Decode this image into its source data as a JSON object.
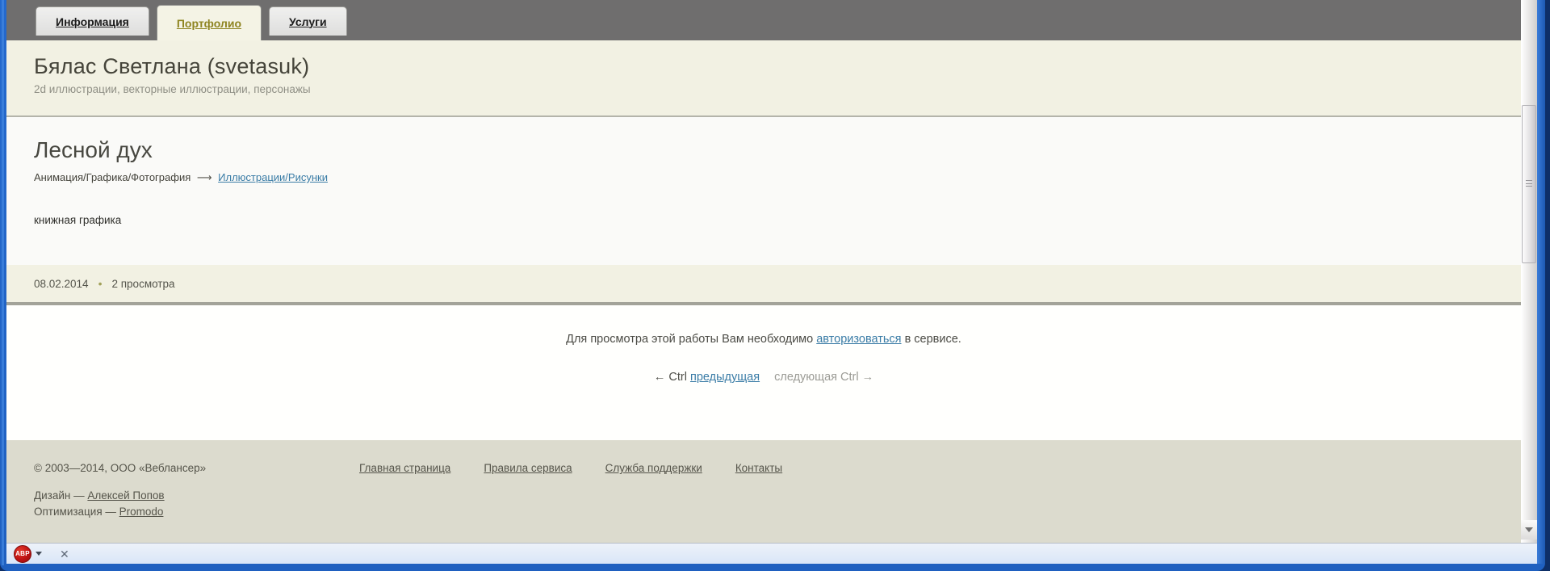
{
  "tabs": [
    {
      "label": "Информация"
    },
    {
      "label": "Портфолио"
    },
    {
      "label": "Услуги"
    }
  ],
  "profile": {
    "name": "Бялас Светлана (svetasuk)",
    "subtitle": "2d иллюстрации, векторные иллюстрации, персонажы"
  },
  "work": {
    "title": "Лесной дух",
    "breadcrumb": {
      "category": "Анимация/Графика/Фотография",
      "arrow": "⟶",
      "link": "Иллюстрации/Рисунки"
    },
    "description": "книжная графика",
    "date": "08.02.2014",
    "bullet": "•",
    "views": "2 просмотра"
  },
  "auth": {
    "text_before": "Для просмотра этой работы Вам необходимо",
    "link": "авторизоваться",
    "text_after": "в сервисе."
  },
  "pager": {
    "prev_hint": "← Ctrl",
    "prev_link": "предыдущая",
    "next_label": "следующая Ctrl →"
  },
  "footer": {
    "copyright": "© 2003—2014, ООО «Веблансер»",
    "links": [
      "Главная страница",
      "Правила сервиса",
      "Служба поддержки",
      "Контакты"
    ],
    "design_prefix": "Дизайн —",
    "design_link": "Алексей Попов",
    "optimization_prefix": "Оптимизация —",
    "optimization_link": "Promodo"
  },
  "statusbar": {
    "abp_label": "ABP",
    "close_icon": "✕"
  },
  "colors": {
    "accent_olive": "#8e8420",
    "link_blue": "#3a7ca6",
    "abp_red": "#c01313",
    "frame_blue": "#2166c8"
  }
}
